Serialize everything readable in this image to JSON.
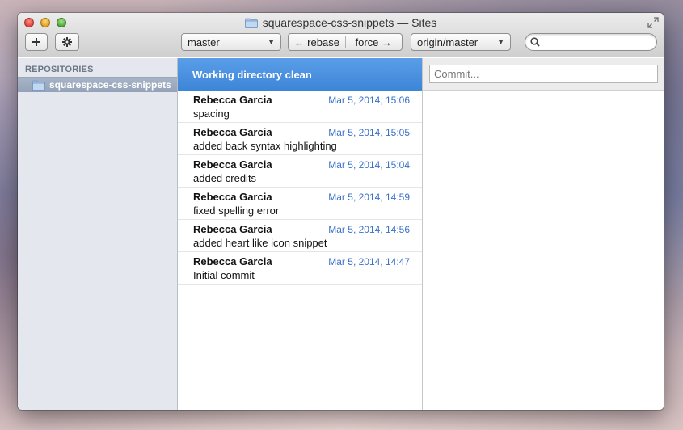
{
  "window": {
    "title": "squarespace-css-snippets — Sites"
  },
  "toolbar": {
    "add_icon": "plus-icon",
    "settings_icon": "gear-icon",
    "branch_select": "master",
    "rebase_label": "← rebase",
    "force_label": "force →",
    "remote_select": "origin/master",
    "search_placeholder": ""
  },
  "sidebar": {
    "heading": "REPOSITORIES",
    "items": [
      {
        "label": "squarespace-css-snippets",
        "icon": "folder-icon"
      }
    ]
  },
  "commits": {
    "status": "Working directory clean",
    "rows": [
      {
        "author": "Rebecca Garcia",
        "date": "Mar 5, 2014, 15:06",
        "message": "spacing"
      },
      {
        "author": "Rebecca Garcia",
        "date": "Mar 5, 2014, 15:05",
        "message": "added back syntax highlighting"
      },
      {
        "author": "Rebecca Garcia",
        "date": "Mar 5, 2014, 15:04",
        "message": "added credits"
      },
      {
        "author": "Rebecca Garcia",
        "date": "Mar 5, 2014, 14:59",
        "message": "fixed spelling error"
      },
      {
        "author": "Rebecca Garcia",
        "date": "Mar 5, 2014, 14:56",
        "message": "added heart like icon snippet"
      },
      {
        "author": "Rebecca Garcia",
        "date": "Mar 5, 2014, 14:47",
        "message": "Initial commit"
      }
    ]
  },
  "detail": {
    "commit_placeholder": "Commit..."
  },
  "colors": {
    "accent": "#4a90e2",
    "date": "#3a72c9",
    "sidebar_bg": "#e4e8ee"
  }
}
